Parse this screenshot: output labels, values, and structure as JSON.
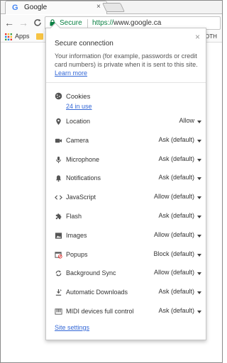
{
  "browser": {
    "tab_title": "Google",
    "tab_close": "×",
    "favicon_letter": "G",
    "nav": {
      "back": "←",
      "forward": "→",
      "reload": "C"
    },
    "omnibox": {
      "secure_label": "Secure",
      "url_scheme": "https://",
      "url_host": "www.google.ca"
    },
    "bookmarks": {
      "apps_label": "Apps",
      "other_label": "OTH"
    }
  },
  "popup": {
    "close": "×",
    "title": "Secure connection",
    "description": "Your information (for example, passwords or credit card numbers) is private when it is sent to this site.",
    "learn_more": "Learn more",
    "cookies": {
      "label": "Cookies",
      "link": "24 in use"
    },
    "permissions": [
      {
        "label": "Location",
        "value": "Allow",
        "icon": "location-icon"
      },
      {
        "label": "Camera",
        "value": "Ask (default)",
        "icon": "camera-icon"
      },
      {
        "label": "Microphone",
        "value": "Ask (default)",
        "icon": "microphone-icon"
      },
      {
        "label": "Notifications",
        "value": "Ask (default)",
        "icon": "bell-icon"
      },
      {
        "label": "JavaScript",
        "value": "Allow (default)",
        "icon": "code-icon"
      },
      {
        "label": "Flash",
        "value": "Ask (default)",
        "icon": "puzzle-icon"
      },
      {
        "label": "Images",
        "value": "Allow (default)",
        "icon": "image-icon"
      },
      {
        "label": "Popups",
        "value": "Block (default)",
        "icon": "popup-icon"
      },
      {
        "label": "Background Sync",
        "value": "Allow (default)",
        "icon": "sync-icon"
      },
      {
        "label": "Automatic Downloads",
        "value": "Ask (default)",
        "icon": "download-icon"
      },
      {
        "label": "MIDI devices full control",
        "value": "Ask (default)",
        "icon": "midi-icon"
      }
    ],
    "site_settings": "Site settings"
  },
  "colors": {
    "secure_green": "#0b8043",
    "link_blue": "#3367d6"
  }
}
